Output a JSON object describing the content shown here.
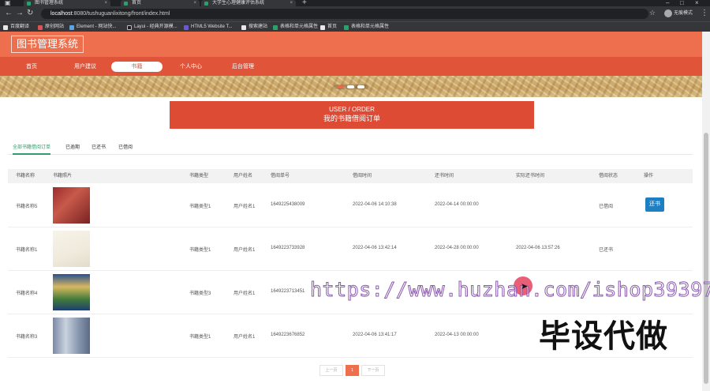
{
  "browser": {
    "tabs": [
      "图书管理系统",
      "首页",
      "大学生心理健康评估系统"
    ],
    "url_host": "localhost",
    "url_rest": ":8080/tushuguanlixitong/front/index.html",
    "profile": "无痕模式",
    "bookmarks": [
      "百度翻译",
      "原创网站",
      "Element - 网站快...",
      "Layui - 经典开源模...",
      "HTML5 Website T...",
      "搜索建站",
      "表格和单元格属性",
      "首页",
      "表格和单元格属性"
    ]
  },
  "site": {
    "logo": "图书管理系统",
    "nav": [
      "首页",
      "用户建议",
      "书籍",
      "个人中心",
      "后台管理"
    ],
    "active_nav": "书籍"
  },
  "order": {
    "title_en": "USER / ORDER",
    "title_cn": "我的书籍借阅订单"
  },
  "subtabs": [
    "全部书籍借阅订单",
    "已逾期",
    "已还书",
    "已借阅"
  ],
  "table": {
    "headers": [
      "书籍名称",
      "书籍照片",
      "书籍类型",
      "用户姓名",
      "借阅单号",
      "借阅时间",
      "还书时间",
      "实际还书时间",
      "借阅状态",
      "操作"
    ],
    "rows": [
      {
        "name": "书籍名称5",
        "type": "书籍类型1",
        "user": "用户姓名1",
        "order_no": "1649225438009",
        "borrow": "2022-04-06 14:10:38",
        "return": "2022-04-14 00:00:00",
        "actual": "",
        "status": "已借阅",
        "action": "还书"
      },
      {
        "name": "书籍名称1",
        "type": "书籍类型1",
        "user": "用户姓名1",
        "order_no": "1649223733928",
        "borrow": "2022-04-06 13:42:14",
        "return": "2022-04-28 00:00:00",
        "actual": "2022-04-06 13:57:26",
        "status": "已还书",
        "action": ""
      },
      {
        "name": "书籍名称4",
        "type": "书籍类型3",
        "user": "用户姓名1",
        "order_no": "1649223713451",
        "borrow": "",
        "return": "",
        "actual": "",
        "status": "",
        "action": ""
      },
      {
        "name": "书籍名称3",
        "type": "书籍类型1",
        "user": "用户姓名1",
        "order_no": "1649223676852",
        "borrow": "2022-04-06 13:41:17",
        "return": "2022-04-13 00:00:00",
        "actual": "",
        "status": "",
        "action": ""
      }
    ]
  },
  "pagination": {
    "prev": "上一页",
    "current": "1",
    "next": "下一页"
  },
  "overlay": {
    "watermark": "https://www.huzhan.com/ishop39397",
    "stamp": "毕设代做"
  },
  "colors": {
    "header": "#ee6f4e",
    "nav": "#e0553a",
    "order_box": "#dd4b35",
    "active_tab": "#2e9e6b",
    "button": "#1e7fc2"
  }
}
